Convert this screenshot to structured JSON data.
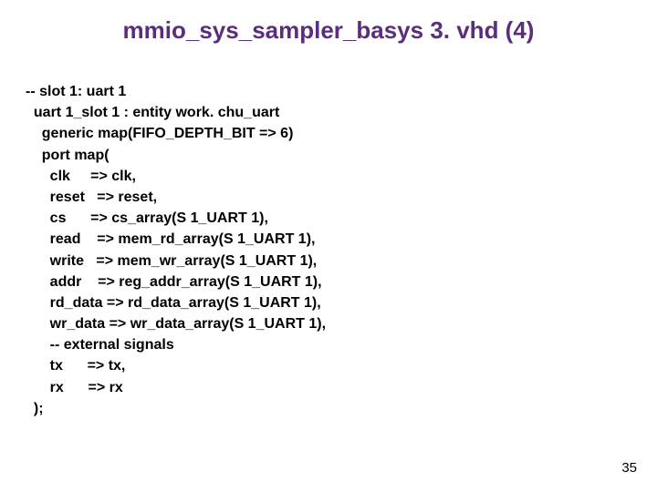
{
  "title": "mmio_sys_sampler_basys 3. vhd (4)",
  "code": {
    "l01": "-- slot 1: uart 1",
    "l02": "  uart 1_slot 1 : entity work. chu_uart",
    "l03": "    generic map(FIFO_DEPTH_BIT => 6)",
    "l04": "    port map(",
    "l05": "      clk     => clk,",
    "l06": "      reset   => reset,",
    "l07": "      cs      => cs_array(S 1_UART 1),",
    "l08": "      read    => mem_rd_array(S 1_UART 1),",
    "l09": "      write   => mem_wr_array(S 1_UART 1),",
    "l10": "      addr    => reg_addr_array(S 1_UART 1),",
    "l11": "      rd_data => rd_data_array(S 1_UART 1),",
    "l12": "      wr_data => wr_data_array(S 1_UART 1),",
    "l13": "      -- external signals",
    "l14": "      tx      => tx,",
    "l15": "      rx      => rx",
    "l16": "  );"
  },
  "page_number": "35"
}
